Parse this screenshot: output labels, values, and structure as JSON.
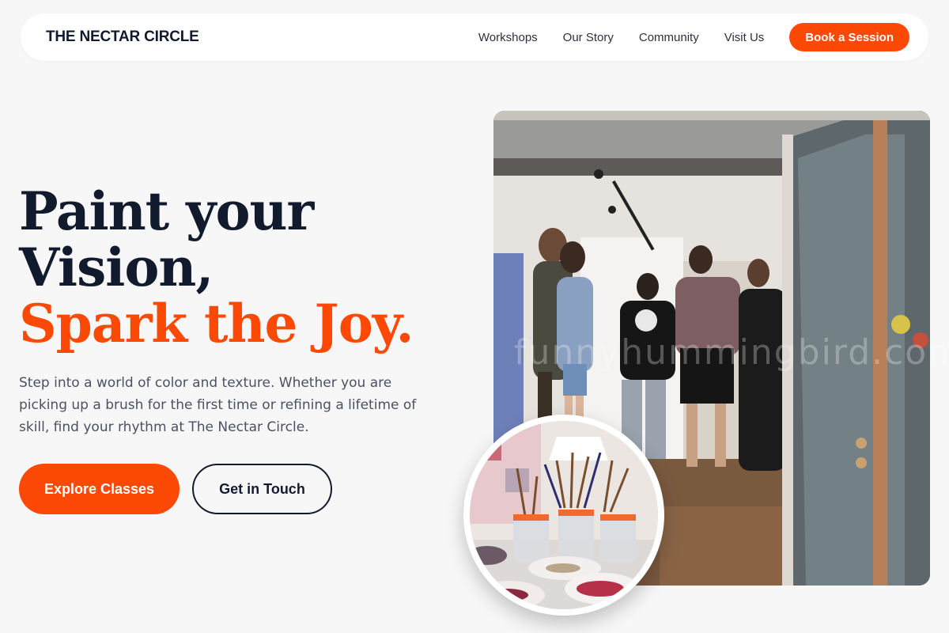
{
  "nav": {
    "brand": "THE NECTAR CIRCLE",
    "links": [
      "Workshops",
      "Our Story",
      "Community",
      "Visit Us"
    ],
    "cta": "Book a Session"
  },
  "hero": {
    "title_line1": "Paint your",
    "title_line2": "Vision,",
    "title_accent": "Spark the Joy.",
    "description": "Step into a world of color and texture. Whether you are picking up a brush for the first time or refining a lifetime of skill, find your rhythm at The Nectar Circle.",
    "primary_button": "Explore Classes",
    "secondary_button": "Get in Touch"
  },
  "media": {
    "watermark": "funnyhummingbird.com",
    "main_photo_icon": "gallery-crowd-photo",
    "inset_photo_icon": "paintbrush-jars-photo"
  },
  "colors": {
    "accent": "#fc4a06",
    "text_dark": "#121a2e",
    "background": "#f7f7f8"
  }
}
